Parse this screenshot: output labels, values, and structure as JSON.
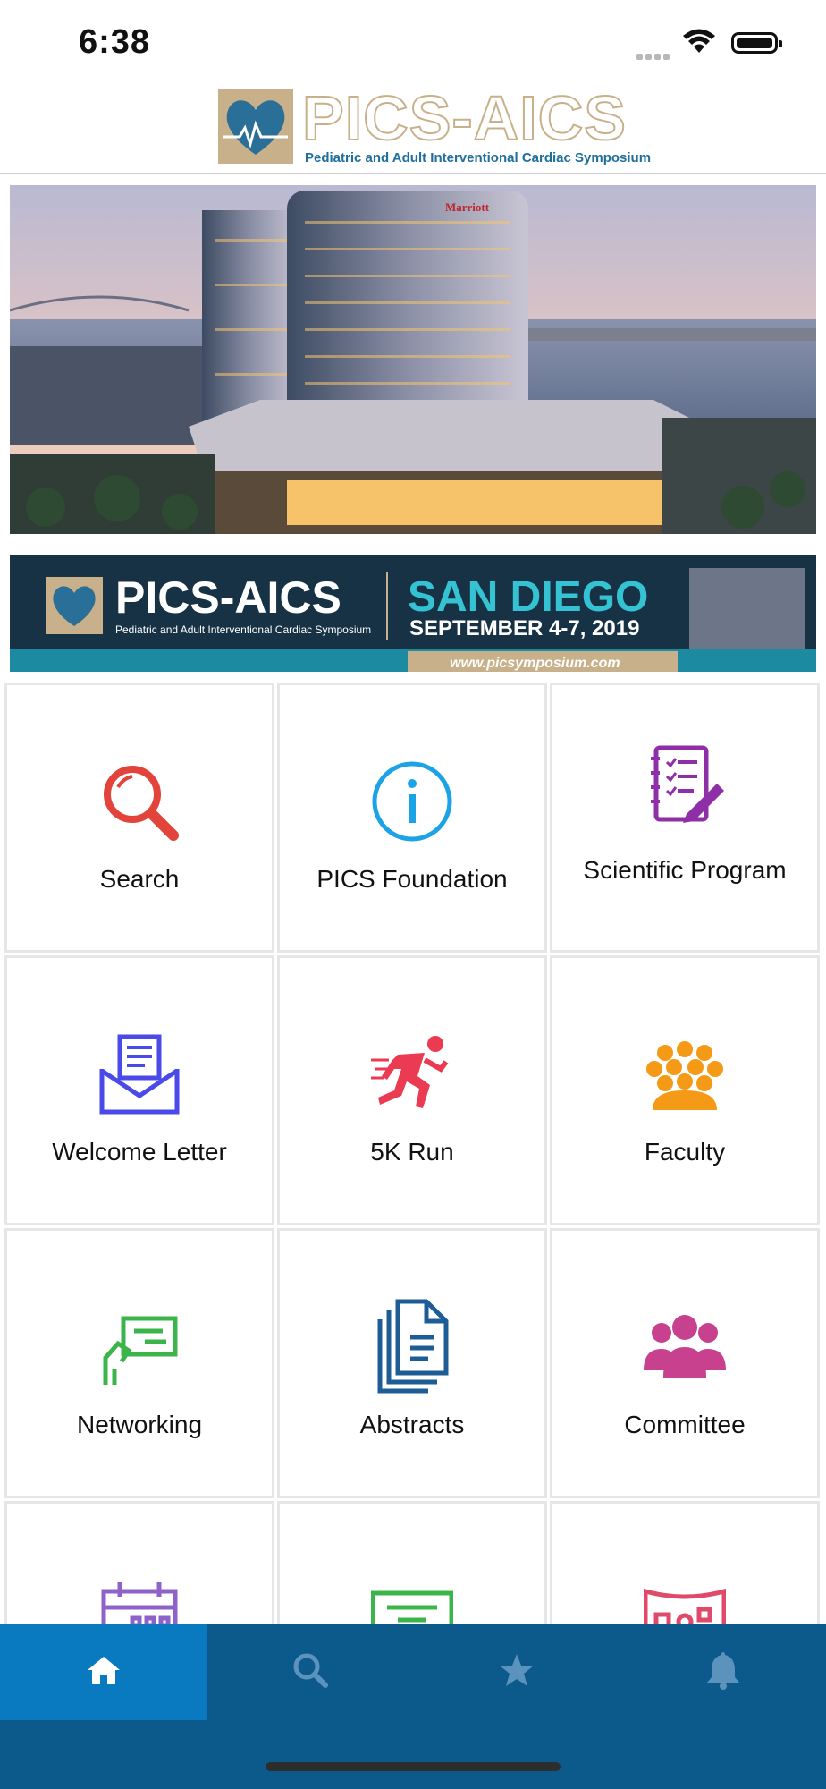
{
  "status_bar": {
    "time": "6:38"
  },
  "header": {
    "logo_title": "PICS-AICS",
    "logo_subtitle": "Pediatric and Adult Interventional Cardiac Symposium"
  },
  "hero": {
    "sign_text": "Marriott"
  },
  "banner": {
    "title": "PICS-AICS",
    "subtitle": "Pediatric and Adult Interventional Cardiac Symposium",
    "city": "SAN DIEGO",
    "dates": "SEPTEMBER 4-7, 2019",
    "url": "www.picsymposium.com"
  },
  "grid": {
    "items": [
      {
        "label": "Search",
        "icon": "magnifier-icon",
        "color": "#e2443b"
      },
      {
        "label": "PICS Foundation",
        "icon": "info-icon",
        "color": "#1ba3e6"
      },
      {
        "label": "Scientific Program",
        "icon": "notebook-checklist-icon",
        "color": "#8e2fa8"
      },
      {
        "label": "Welcome Letter",
        "icon": "envelope-letter-icon",
        "color": "#4a4ae8"
      },
      {
        "label": "5K Run",
        "icon": "runner-icon",
        "color": "#ea3b52"
      },
      {
        "label": "Faculty",
        "icon": "crowd-icon",
        "color": "#f59a16"
      },
      {
        "label": "Networking",
        "icon": "business-card-icon",
        "color": "#3bb54a"
      },
      {
        "label": "Abstracts",
        "icon": "documents-icon",
        "color": "#1d5c94"
      },
      {
        "label": "Committee",
        "icon": "group-icon",
        "color": "#c7418f"
      },
      {
        "label": "",
        "icon": "calendar-icon",
        "color": "#8e62c8"
      },
      {
        "label": "",
        "icon": "sign-board-icon",
        "color": "#3bb54a"
      },
      {
        "label": "",
        "icon": "map-icon",
        "color": "#e04a6a"
      }
    ]
  },
  "tabbar": {
    "tabs": [
      {
        "name": "home",
        "icon": "home-icon",
        "active": true
      },
      {
        "name": "search",
        "icon": "search-icon",
        "active": false
      },
      {
        "name": "favorites",
        "icon": "star-icon",
        "active": false
      },
      {
        "name": "notifications",
        "icon": "bell-icon",
        "active": false
      }
    ],
    "colors": {
      "bar": "#0c5a8c",
      "active": "#0a7ac0",
      "active_icon": "#ffffff",
      "inactive_icon": "#5b93bd"
    }
  }
}
